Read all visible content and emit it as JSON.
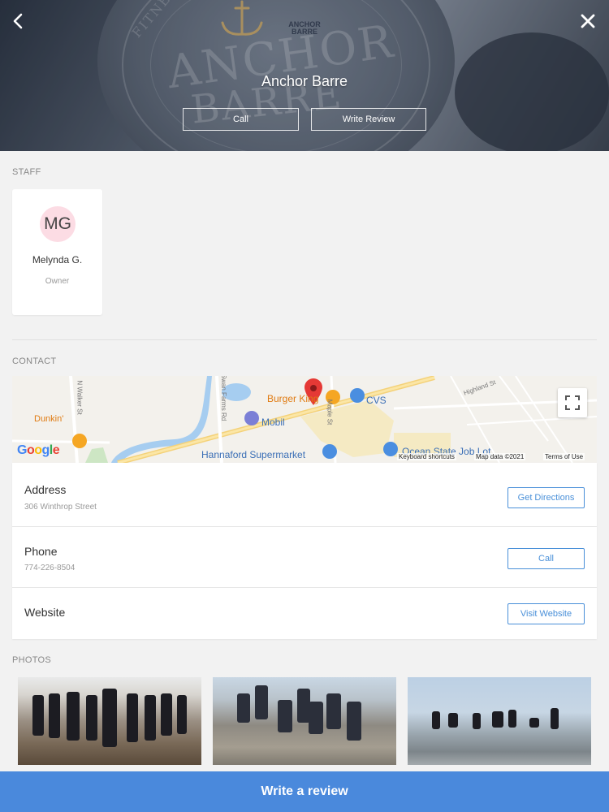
{
  "header": {
    "title": "Anchor Barre",
    "call_label": "Call",
    "write_review_label": "Write Review",
    "back_icon": "chevron-left-icon",
    "close_icon": "close-icon",
    "watermark_line1": "ANCHOR",
    "watermark_line2": "BARRE",
    "watermark_arc": "FITNESS",
    "logo_text": "ANCHOR BARRE"
  },
  "staff": {
    "section_label": "STAFF",
    "members": [
      {
        "initials": "MG",
        "name": "Melynda G.",
        "role": "Owner"
      }
    ]
  },
  "contact": {
    "section_label": "CONTACT",
    "map": {
      "places": [
        "Burger King",
        "CVS",
        "Mobil",
        "Hannaford Supermarket",
        "Dunkin'",
        "Ocean State Job Lot"
      ],
      "streets": [
        "N Walker St",
        "Swan Farms Rd",
        "Maple St",
        "Highland St"
      ],
      "google_logo": "Google",
      "keyboard_shortcuts": "Keyboard shortcuts",
      "map_data": "Map data ©2021",
      "terms": "Terms of Use"
    },
    "address": {
      "label": "Address",
      "value": "306 Winthrop Street",
      "button": "Get Directions"
    },
    "phone": {
      "label": "Phone",
      "value": "774-226-8504",
      "button": "Call"
    },
    "website": {
      "label": "Website",
      "button": "Visit Website"
    }
  },
  "photos": {
    "section_label": "PHOTOS"
  },
  "footer": {
    "write_review_label": "Write a review",
    "accent_color": "#4a89dc"
  }
}
